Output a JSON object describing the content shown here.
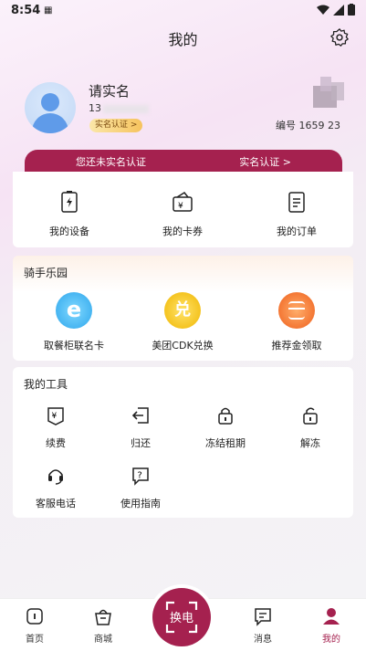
{
  "status": {
    "time": "8:54",
    "sim": "SIM"
  },
  "header": {
    "title": "我的"
  },
  "profile": {
    "name": "请实名",
    "phone_prefix": "13",
    "verify_button": "实名认证 >",
    "serial": "编号 1659 23"
  },
  "banner": {
    "notice": "您还未实名认证",
    "action": "实名认证 >"
  },
  "quick": [
    {
      "label": "我的设备",
      "icon": "battery-icon"
    },
    {
      "label": "我的卡券",
      "icon": "coupon-icon"
    },
    {
      "label": "我的订单",
      "icon": "order-icon"
    }
  ],
  "park": {
    "title": "骑手乐园",
    "items": [
      {
        "label": "取餐柜联名卡",
        "icon": "e-card-icon",
        "glyph": "e",
        "color": "#48b8f0"
      },
      {
        "label": "美团CDK兑换",
        "icon": "redeem-icon",
        "glyph": "兑",
        "color": "#f3c316"
      },
      {
        "label": "推荐金领取",
        "icon": "coins-icon",
        "glyph": "",
        "color": "#f4772c"
      }
    ]
  },
  "tools": {
    "title": "我的工具",
    "items": [
      {
        "label": "续费",
        "icon": "renew-icon"
      },
      {
        "label": "归还",
        "icon": "return-icon"
      },
      {
        "label": "冻结租期",
        "icon": "lock-icon"
      },
      {
        "label": "解冻",
        "icon": "unlock-icon"
      },
      {
        "label": "客服电话",
        "icon": "headset-icon"
      },
      {
        "label": "使用指南",
        "icon": "guide-icon"
      }
    ]
  },
  "tabs": [
    {
      "label": "首页",
      "icon": "home-icon"
    },
    {
      "label": "商城",
      "icon": "shop-icon"
    },
    {
      "label": "换电",
      "icon": "scan-icon"
    },
    {
      "label": "消息",
      "icon": "message-icon"
    },
    {
      "label": "我的",
      "icon": "user-icon"
    }
  ],
  "colors": {
    "accent": "#a5214f",
    "gold": "#f6c35d"
  }
}
